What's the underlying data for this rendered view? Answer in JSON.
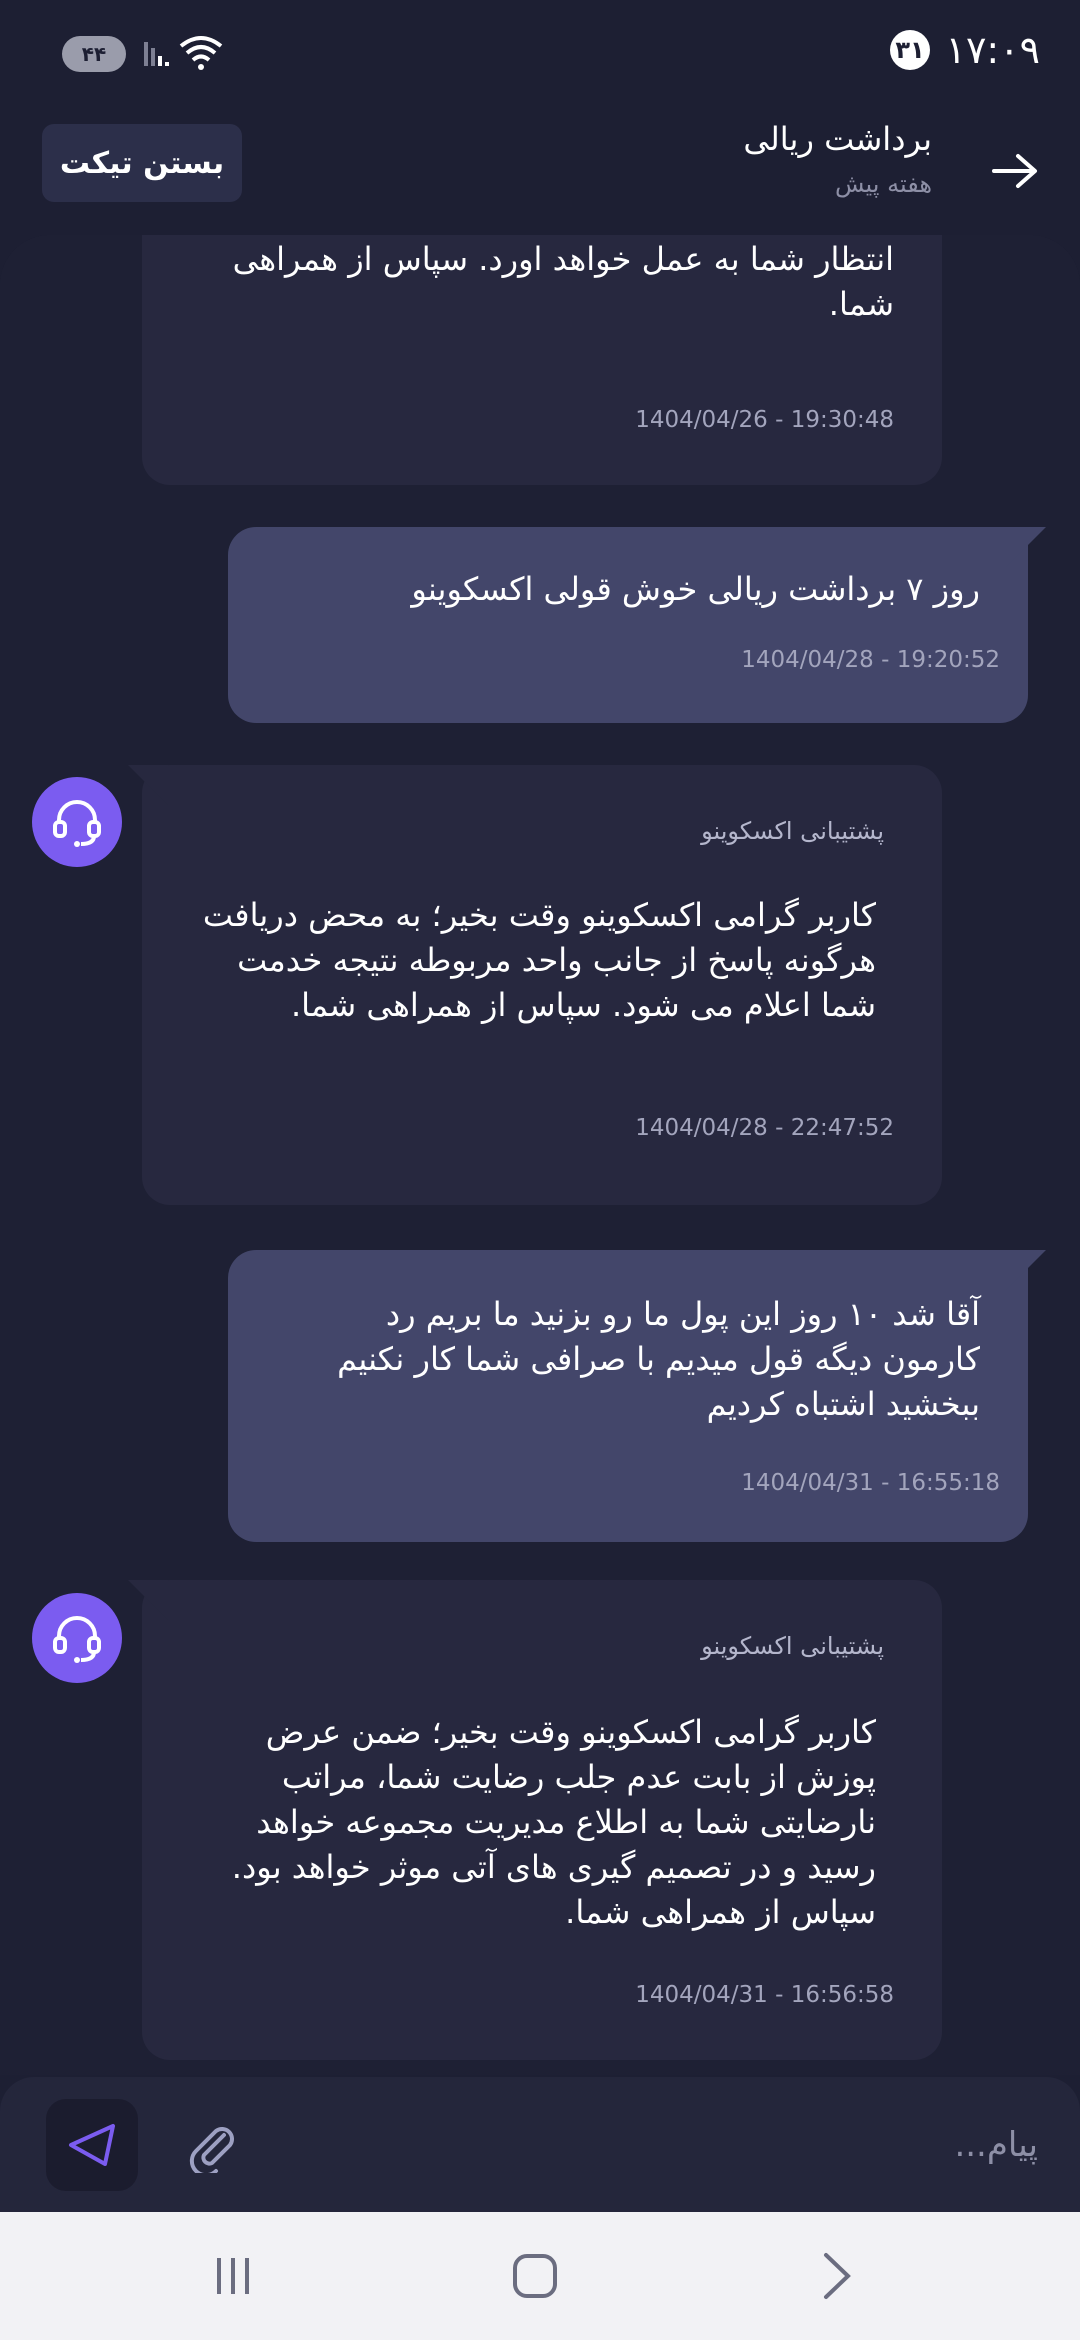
{
  "status_bar": {
    "time": "۱۷:۰۹",
    "date_badge": "۳۱",
    "battery": "۴۴"
  },
  "header": {
    "title": "برداشت ریالی",
    "subtitle": "هفته پیش",
    "close_ticket_label": "بستن تیکت"
  },
  "messages": [
    {
      "role": "support",
      "text": "انتظار شما به عمل خواهد اورد. سپاس از همراهی شما.",
      "time": "1404/04/26 - 19:30:48"
    },
    {
      "role": "user",
      "text": "روز ۷ برداشت ریالی خوش قولی اکسکوینو",
      "time": "1404/04/28 - 19:20:52"
    },
    {
      "role": "support",
      "sender": "پشتیبانی اکسکوینو",
      "text": "کاربر گرامی اکسکوینو وقت بخیر؛ به محض دریافت هرگونه پاسخ از جانب واحد مربوطه نتیجه خدمت شما اعلام می شود. سپاس از همراهی شما.",
      "time": "1404/04/28 - 22:47:52"
    },
    {
      "role": "user",
      "text": "آقا شد ۱۰ روز این پول ما رو بزنید ما بریم رد کارمون دیگه قول میدیم با صرافی شما کار نکنیم ببخشید اشتباه کردیم",
      "time": "1404/04/31 - 16:55:18"
    },
    {
      "role": "support",
      "sender": "پشتیبانی اکسکوینو",
      "text": "کاربر گرامی اکسکوینو وقت بخیر؛ ضمن عرض پوزش از بابت عدم جلب رضایت شما، مراتب نارضایتی شما به اطلاع مدیریت مجموعه خواهد رسید و در تصمیم گیری های آتی موثر خواهد بود. سپاس از همراهی شما.",
      "time": "1404/04/31 - 16:56:58"
    }
  ],
  "composer": {
    "placeholder": "پیام..."
  },
  "icons": {
    "back": "arrow-right-icon",
    "avatar": "headset-icon",
    "send": "send-icon",
    "attach": "paperclip-icon",
    "nav_recent": "recent-apps-icon",
    "nav_home": "home-icon",
    "nav_back": "back-chevron-icon"
  },
  "colors": {
    "accent": "#7b5cf0",
    "user_bubble": "#43466a",
    "support_bubble": "#27283f",
    "background": "#1d1f33"
  }
}
